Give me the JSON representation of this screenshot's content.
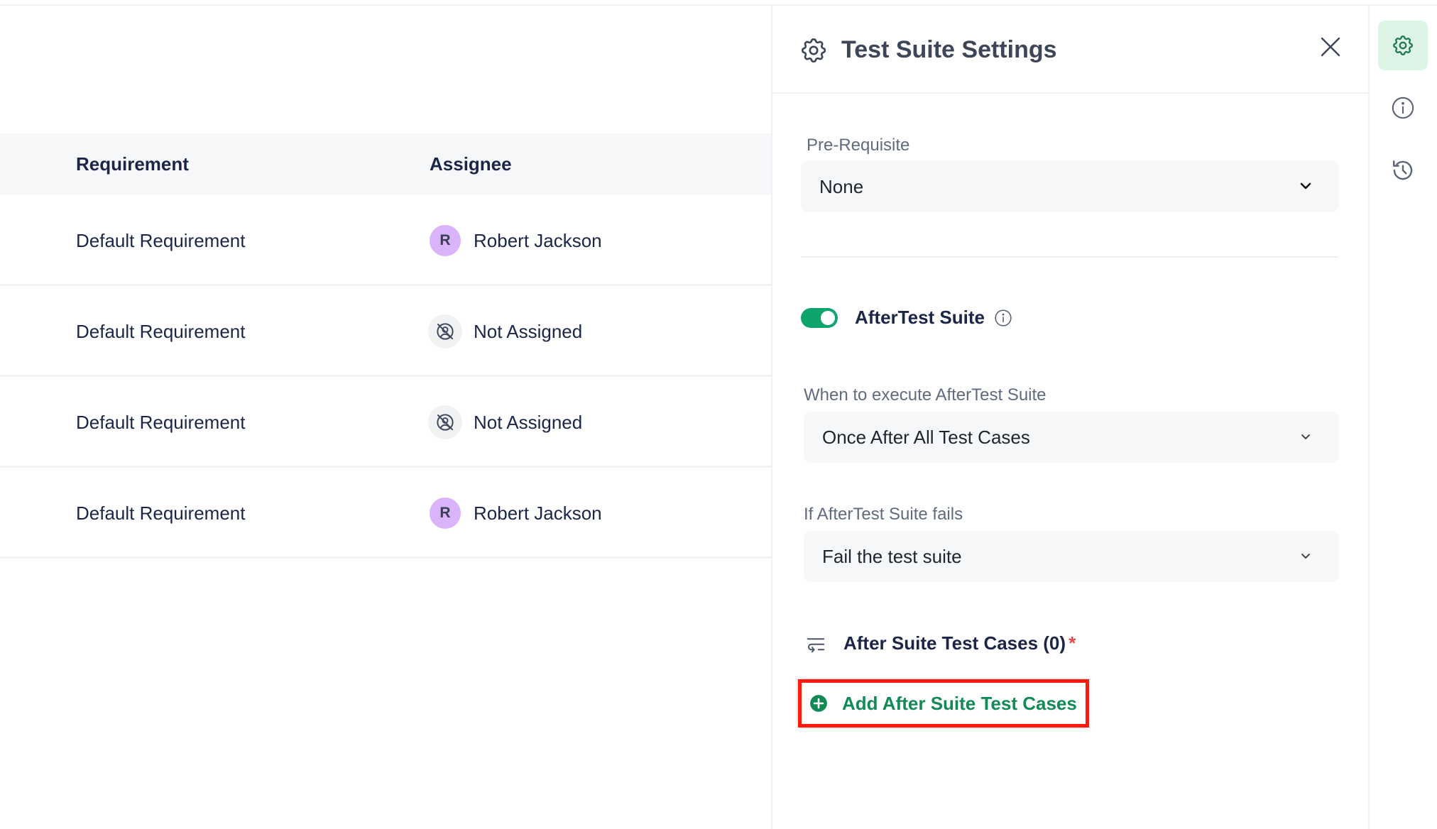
{
  "table": {
    "columns": {
      "requirement": "Requirement",
      "assignee": "Assignee"
    },
    "rows": [
      {
        "requirement": "Default Requirement",
        "assignee": "Robert Jackson",
        "avatar_initial": "R",
        "assigned": true
      },
      {
        "requirement": "Default Requirement",
        "assignee": "Not Assigned",
        "assigned": false
      },
      {
        "requirement": "Default Requirement",
        "assignee": "Not Assigned",
        "assigned": false
      },
      {
        "requirement": "Default Requirement",
        "assignee": "Robert Jackson",
        "avatar_initial": "R",
        "assigned": true
      }
    ]
  },
  "panel": {
    "title": "Test Suite Settings",
    "title_icon": "gear-icon",
    "close_icon": "close-icon",
    "prerequisite": {
      "label": "Pre-Requisite",
      "value": "None"
    },
    "after_test_suite": {
      "label": "AfterTest Suite",
      "enabled": true,
      "info_icon": "info-icon"
    },
    "when_to_execute": {
      "label": "When to execute AfterTest Suite",
      "value": "Once After All Test Cases"
    },
    "if_fails": {
      "label": "If AfterTest Suite fails",
      "value": "Fail the test suite"
    },
    "after_cases": {
      "title": "After Suite Test Cases (0)",
      "required_marker": "*",
      "icon": "test-cases-list-icon"
    },
    "add_button": {
      "label": "Add After Suite Test Cases",
      "icon": "plus-circle-icon"
    }
  },
  "rail": {
    "items": [
      {
        "name": "settings",
        "icon": "gear-icon",
        "active": true
      },
      {
        "name": "info",
        "icon": "info-icon",
        "active": false
      },
      {
        "name": "history",
        "icon": "history-icon",
        "active": false
      }
    ]
  },
  "colors": {
    "accent_green": "#0ea56c",
    "add_button_text": "#128a55",
    "highlight_box": "#ff1a0d",
    "avatar_bg": "#d9b4fb",
    "rail_active_bg": "#dcf3e6",
    "required_star": "#e5484d"
  }
}
